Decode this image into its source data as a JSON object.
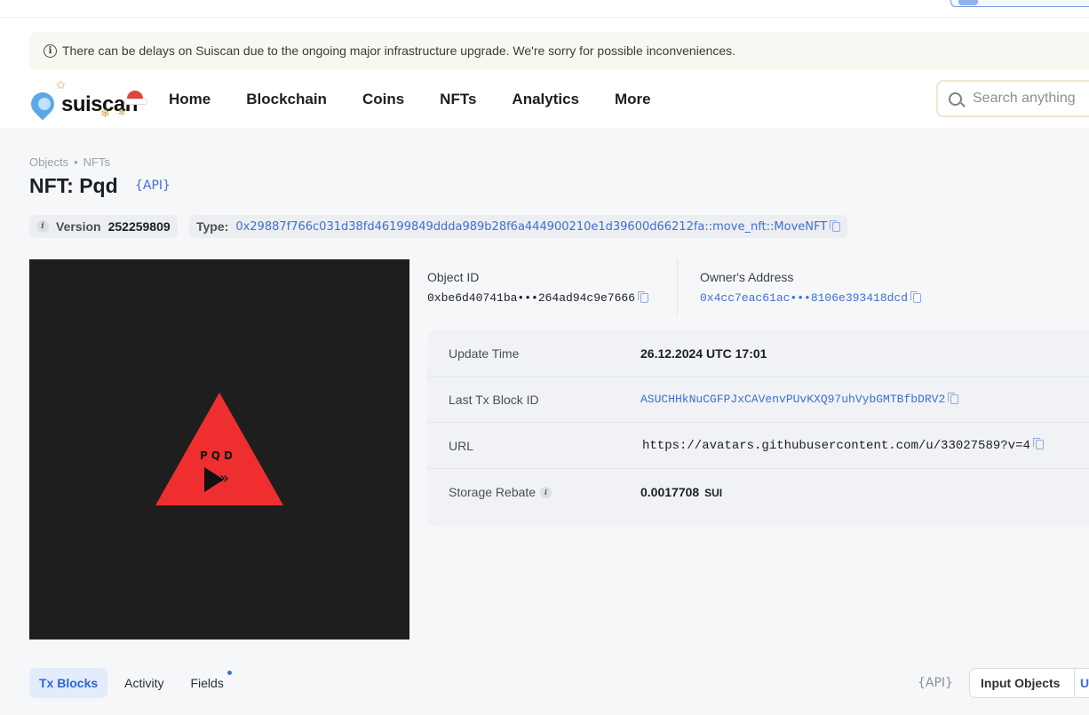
{
  "banner": {
    "text": "There can be delays on Suiscan due to the ongoing major infrastructure upgrade. We're sorry for possible inconveniences."
  },
  "header": {
    "logo_text": "suiscan",
    "nav": [
      "Home",
      "Blockchain",
      "Coins",
      "NFTs",
      "Analytics",
      "More"
    ],
    "search_placeholder": "Search anything"
  },
  "breadcrumb": [
    "Objects",
    "NFTs"
  ],
  "page": {
    "title": "NFT: Pqd",
    "api_label": "{API}"
  },
  "version": {
    "label": "Version",
    "value": "252259809"
  },
  "type": {
    "label": "Type:",
    "value": "0x29887f766c031d38fd46199849ddda989b28f6a444900210e1d39600d66212fa::move_nft::MoveNFT"
  },
  "nft_image": {
    "text": "PQD"
  },
  "object": {
    "object_id_label": "Object ID",
    "object_id_value": "0xbe6d40741ba•••264ad94c9e7666",
    "owner_label": "Owner's Address",
    "owner_value": "0x4cc7eac61ac•••8106e393418dcd"
  },
  "details": [
    {
      "key": "Update Time",
      "value": "26.12.2024 UTC 17:01"
    },
    {
      "key": "Last Tx Block ID",
      "value": "ASUCHHkNuCGFPJxCAVenvPUvKXQ97uhVybGMTBfbDRV2"
    },
    {
      "key": "URL",
      "value": "https://avatars.githubusercontent.com/u/33027589?v=4"
    },
    {
      "key": "Storage Rebate",
      "value": "0.0017708",
      "unit": "SUI"
    }
  ],
  "tabs": [
    "Tx Blocks",
    "Activity",
    "Fields"
  ],
  "bottom": {
    "api_label": "{API}",
    "segment_active": "Input Objects",
    "segment_next": "U"
  }
}
